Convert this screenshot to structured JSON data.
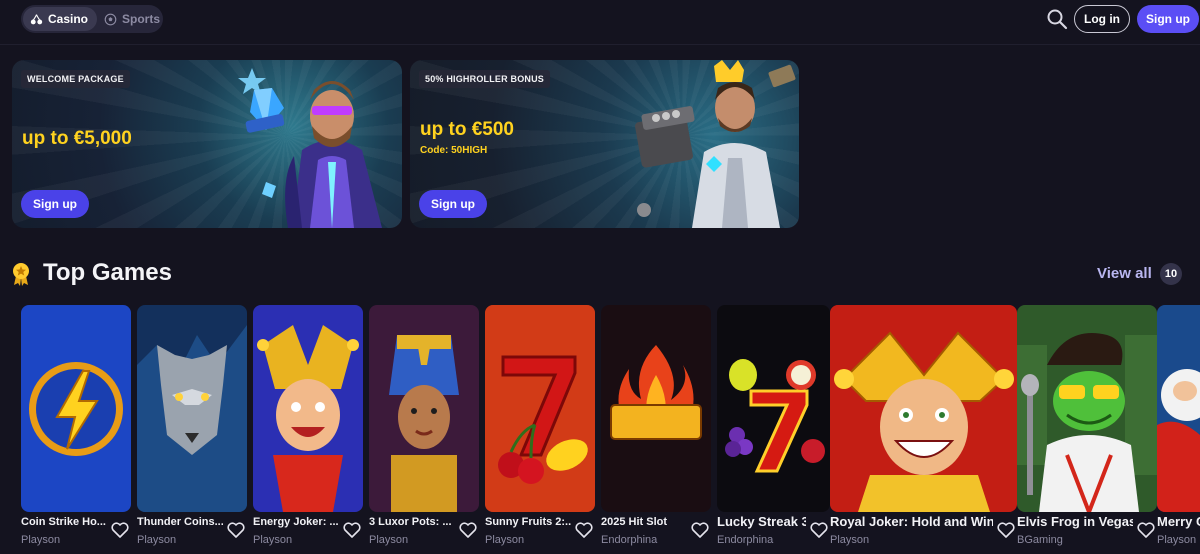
{
  "nav": {
    "tabs": [
      {
        "label": "Casino",
        "icon": "cherries-icon",
        "active": true
      },
      {
        "label": "Sports",
        "icon": "soccer-ball-icon",
        "active": false
      }
    ],
    "login_label": "Log in",
    "signup_label": "Sign up"
  },
  "promos": [
    {
      "tag": "WELCOME PACKAGE",
      "amount": "up to €5,000",
      "code": "",
      "cta": "Sign up"
    },
    {
      "tag": "50% HIGHROLLER BONUS",
      "amount": "up to €500",
      "code": "Code: 50HIGH",
      "cta": "Sign up"
    }
  ],
  "top_games": {
    "title": "Top Games",
    "view_all_label": "View all",
    "count": "10",
    "games": [
      {
        "name": "Coin Strike Ho...",
        "provider": "Playson"
      },
      {
        "name": "Thunder Coins...",
        "provider": "Playson"
      },
      {
        "name": "Energy Joker: ...",
        "provider": "Playson"
      },
      {
        "name": "3 Luxor Pots: ...",
        "provider": "Playson"
      },
      {
        "name": "Sunny Fruits 2:...",
        "provider": "Playson"
      },
      {
        "name": "2025 Hit Slot",
        "provider": "Endorphina"
      },
      {
        "name": "Lucky Streak 3",
        "provider": "Endorphina"
      },
      {
        "name": "Royal Joker: Hold and Win",
        "provider": "Playson"
      },
      {
        "name": "Elvis Frog in Vegas",
        "provider": "BGaming"
      },
      {
        "name": "Merry C",
        "provider": "Playson"
      }
    ]
  },
  "colors": {
    "background": "#14131f",
    "accent": "#5b4ef5",
    "bonus_yellow": "#ffd21f",
    "view_all": "#b9b6f0"
  }
}
